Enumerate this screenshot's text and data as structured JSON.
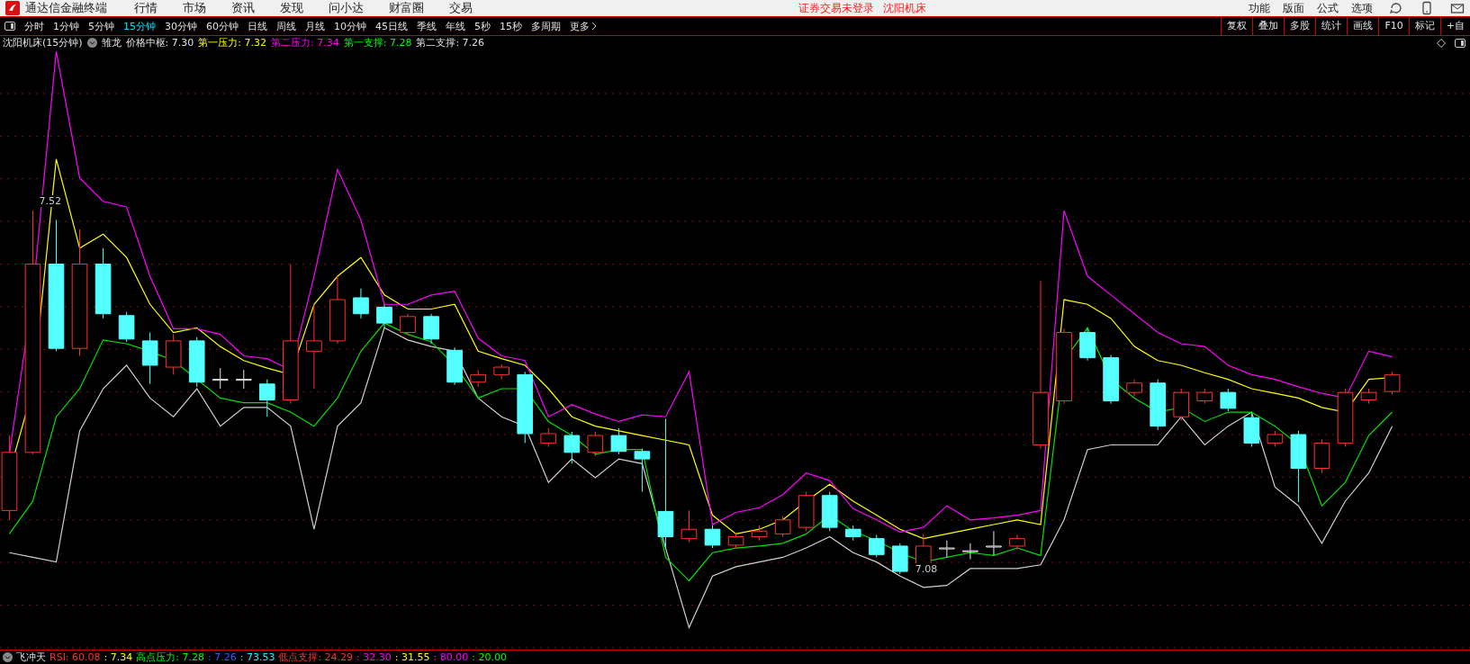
{
  "app": {
    "title": "通达信金融终端"
  },
  "menu": [
    "行情",
    "市场",
    "资讯",
    "发现",
    "问小达",
    "财富圈",
    "交易"
  ],
  "notice": [
    "证券交易未登录",
    "沈阳机床"
  ],
  "right_menu": [
    "功能",
    "版面",
    "公式",
    "选项"
  ],
  "periods": [
    {
      "label": "分时",
      "selected": false
    },
    {
      "label": "1分钟",
      "selected": false
    },
    {
      "label": "5分钟",
      "selected": false
    },
    {
      "label": "15分钟",
      "selected": true
    },
    {
      "label": "30分钟",
      "selected": false
    },
    {
      "label": "60分钟",
      "selected": false
    },
    {
      "label": "日线",
      "selected": false
    },
    {
      "label": "周线",
      "selected": false
    },
    {
      "label": "月线",
      "selected": false
    },
    {
      "label": "10分钟",
      "selected": false
    },
    {
      "label": "45日线",
      "selected": false
    },
    {
      "label": "季线",
      "selected": false
    },
    {
      "label": "年线",
      "selected": false
    },
    {
      "label": "5秒",
      "selected": false
    },
    {
      "label": "15秒",
      "selected": false
    },
    {
      "label": "多周期",
      "selected": false
    }
  ],
  "more": "更多",
  "tools": [
    "复权",
    "叠加",
    "多股",
    "统计",
    "画线",
    "F10",
    "标记",
    "+自"
  ],
  "legend": {
    "title": "沈阳机床(15分钟)",
    "indicator": "雏龙",
    "items": [
      {
        "text": "价格中枢: 7.30",
        "color": "#e0e0e0"
      },
      {
        "text": "第一压力: 7.32",
        "color": "#ffff00"
      },
      {
        "text": "第二压力: 7.34",
        "color": "#ff00ff"
      },
      {
        "text": "第一支撑: 7.28",
        "color": "#00ff00"
      },
      {
        "text": "第二支撑: 7.26",
        "color": "#e0e0e0"
      }
    ]
  },
  "chart_labels": [
    "7.52",
    "7.08"
  ],
  "bottom": {
    "indicator": "飞冲天",
    "items": [
      {
        "text": "RSI: 60.08",
        "color": "#ff3030"
      },
      {
        "text": ": 7.34",
        "color": "#ffff00"
      },
      {
        "text": "高点压力: 7.28",
        "color": "#00ff00"
      },
      {
        "text": ": 7.26",
        "color": "#3060ff"
      },
      {
        "text": ": 73.53",
        "color": "#00ffff"
      },
      {
        "text": "低点支撑: 24.29",
        "color": "#ff3030"
      },
      {
        "text": ": 32.30",
        "color": "#ff00ff"
      },
      {
        "text": ": 31.55",
        "color": "#ffff00"
      },
      {
        "text": ": 80.00",
        "color": "#ff00ff"
      },
      {
        "text": ": 20.00",
        "color": "#00ff00"
      }
    ]
  }
}
